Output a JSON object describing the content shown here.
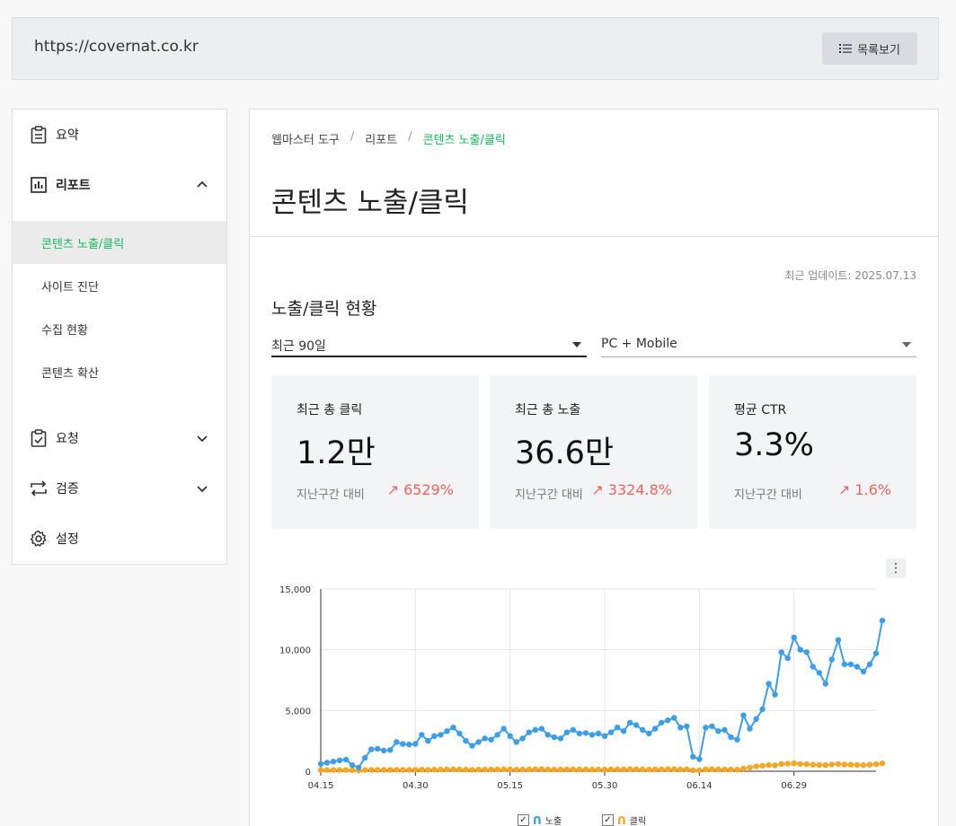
{
  "topbar": {
    "url": "https://covernat.co.kr",
    "list_button": "목록보기"
  },
  "sidebar": {
    "items": [
      {
        "label": "요약"
      },
      {
        "label": "리포트"
      },
      {
        "label": "요청"
      },
      {
        "label": "검증"
      },
      {
        "label": "설정"
      }
    ],
    "subitems": [
      {
        "label": "콘텐츠 노출/클릭"
      },
      {
        "label": "사이트 진단"
      },
      {
        "label": "수집 현황"
      },
      {
        "label": "콘텐츠 확산"
      }
    ]
  },
  "breadcrumb": {
    "root": "웹마스터 도구",
    "parent": "리포트",
    "current": "콘텐츠 노출/클릭",
    "sep": "/"
  },
  "page_title": "콘텐츠 노출/클릭",
  "updated": "최근 업데이트: 2025.07.13",
  "section_title": "노출/클릭 현황",
  "filters": {
    "period": "최근 90일",
    "device": "PC + Mobile"
  },
  "cards": [
    {
      "title": "최근 총 클릭",
      "value": "1.2만",
      "compare_label": "지난구간 대비",
      "delta": "↗ 6529%"
    },
    {
      "title": "최근 총 노출",
      "value": "36.6만",
      "compare_label": "지난구간 대비",
      "delta": "↗ 3324.8%"
    },
    {
      "title": "평균 CTR",
      "value": "3.3%",
      "compare_label": "지난구간 대비",
      "delta": "↗ 1.6%"
    }
  ],
  "colors": {
    "accent": "#17b75e",
    "impressions": "#3d9ee8",
    "clicks": "#f5a623",
    "delta_up": "#f0625f"
  },
  "chart_data": {
    "type": "line",
    "x": [
      "04.15",
      "04.16",
      "04.17",
      "04.18",
      "04.19",
      "04.20",
      "04.21",
      "04.22",
      "04.23",
      "04.24",
      "04.25",
      "04.26",
      "04.27",
      "04.28",
      "04.29",
      "04.30",
      "05.01",
      "05.02",
      "05.03",
      "05.04",
      "05.05",
      "05.06",
      "05.07",
      "05.08",
      "05.09",
      "05.10",
      "05.11",
      "05.12",
      "05.13",
      "05.14",
      "05.15",
      "05.16",
      "05.17",
      "05.18",
      "05.19",
      "05.20",
      "05.21",
      "05.22",
      "05.23",
      "05.24",
      "05.25",
      "05.26",
      "05.27",
      "05.28",
      "05.29",
      "05.30",
      "05.31",
      "06.01",
      "06.02",
      "06.03",
      "06.04",
      "06.05",
      "06.06",
      "06.07",
      "06.08",
      "06.09",
      "06.10",
      "06.11",
      "06.12",
      "06.13",
      "06.14",
      "06.15",
      "06.16",
      "06.17",
      "06.18",
      "06.19",
      "06.20",
      "06.21",
      "06.22",
      "06.23",
      "06.24",
      "06.25",
      "06.26",
      "06.27",
      "06.28",
      "06.29",
      "06.30",
      "07.01",
      "07.02",
      "07.03",
      "07.04",
      "07.05",
      "07.06",
      "07.07",
      "07.08",
      "07.09",
      "07.10",
      "07.11",
      "07.12"
    ],
    "x_ticks": [
      "04.15",
      "04.30",
      "05.15",
      "05.30",
      "06.14",
      "06.29"
    ],
    "y_ticks": [
      "0",
      "5,000",
      "10,000",
      "15,000"
    ],
    "ylim": [
      0,
      15000
    ],
    "grid": true,
    "legend": "bottom",
    "series": [
      {
        "name": "노출",
        "values": [
          600,
          700,
          800,
          900,
          950,
          500,
          300,
          1100,
          1800,
          1850,
          1700,
          1750,
          2400,
          2250,
          2200,
          2250,
          3000,
          2500,
          2900,
          3000,
          3300,
          3600,
          3100,
          2500,
          2100,
          2400,
          2700,
          2600,
          3000,
          3500,
          2900,
          2400,
          2700,
          3200,
          3400,
          3500,
          3000,
          2800,
          2700,
          3200,
          3400,
          3100,
          3150,
          3000,
          3100,
          2900,
          3200,
          3600,
          3300,
          4000,
          3800,
          3400,
          3100,
          3500,
          4000,
          4200,
          4400,
          3600,
          3700,
          1200,
          1000,
          3600,
          3700,
          3300,
          3400,
          2800,
          2600,
          4600,
          3500,
          4300,
          5100,
          7200,
          6300,
          9800,
          9300,
          11000,
          10000,
          9800,
          8600,
          8100,
          7200,
          9200,
          10800,
          8800,
          8800,
          8600,
          8200,
          8800,
          9700,
          12400
        ]
      },
      {
        "name": "클릭",
        "values": [
          100,
          100,
          100,
          100,
          100,
          80,
          60,
          100,
          110,
          110,
          110,
          110,
          120,
          120,
          120,
          120,
          130,
          120,
          130,
          140,
          150,
          160,
          150,
          130,
          120,
          130,
          140,
          140,
          150,
          160,
          150,
          130,
          140,
          150,
          160,
          170,
          150,
          140,
          140,
          150,
          160,
          150,
          150,
          140,
          150,
          140,
          150,
          160,
          150,
          170,
          160,
          150,
          140,
          150,
          160,
          170,
          180,
          150,
          160,
          80,
          70,
          160,
          170,
          150,
          150,
          140,
          130,
          220,
          300,
          400,
          450,
          500,
          480,
          600,
          620,
          650,
          600,
          580,
          540,
          520,
          500,
          560,
          600,
          550,
          540,
          520,
          500,
          540,
          580,
          650
        ]
      }
    ]
  }
}
